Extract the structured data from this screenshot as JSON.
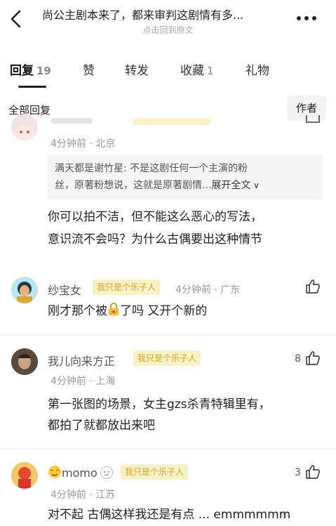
{
  "header": {
    "title": "尚公主剧本来了，都来审判这剧情有多...",
    "subtitle": "点击回到原文"
  },
  "tabs": [
    {
      "label": "回复",
      "count": "19"
    },
    {
      "label": "赞",
      "count": ""
    },
    {
      "label": "转发",
      "count": ""
    },
    {
      "label": "收藏",
      "count": "1"
    },
    {
      "label": "礼物",
      "count": ""
    }
  ],
  "filter": {
    "all_label": "全部回复",
    "author_label": "作者"
  },
  "comments": [
    {
      "meta": "4分钟前 · 北京",
      "quote_user": "满天都是谢竹星:",
      "quote_text_1": "不是这剧任何一个主演的粉",
      "quote_text_2": "丝，原著粉想说，这就是原著剧情...",
      "quote_expand": "展开全文",
      "text_1": "你可以拍不洁，但不能这么恶心的写法，",
      "text_2": "意识流不会吗？为什么古偶要出这种情节"
    },
    {
      "name": "纱宝女",
      "badge": "我只是个乐子人",
      "meta": "4分钟前 · 广东",
      "text_1a": "刚才那个被",
      "text_1b": "了吗 又开个新的"
    },
    {
      "name": "我儿向来方正",
      "badge": "我只是个乐子人",
      "meta": "4分钟前 · 上海",
      "likes": "8",
      "text_1": "第一张图的场景，女主gzs杀青特辑里有，",
      "text_2": "都拍了就都放出来吧"
    },
    {
      "name": "momo",
      "badge": "我只是个乐子人",
      "meta": "4分钟前 · 江苏",
      "likes": "3",
      "text_1": "对不起 古偶这样我还是有点 ... emmmmmm"
    }
  ],
  "colors": {
    "badge_bg": "#f7f1c8",
    "badge_text": "#d9a21b",
    "meta": "#999999"
  }
}
